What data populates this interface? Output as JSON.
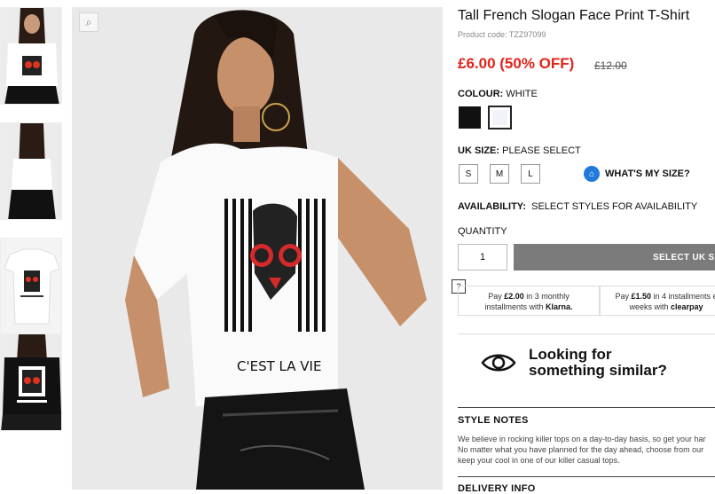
{
  "product": {
    "title": "Tall French Slogan Face Print T-Shirt",
    "code": "Product code: TZZ97099",
    "price": "£6.00 (50% OFF)",
    "was_price": "£12.00"
  },
  "gallery": {
    "thumbnails": [
      "front view",
      "back view",
      "flat lay",
      "black variant"
    ],
    "print_text": "C'EST LA VIE"
  },
  "colour": {
    "label": "COLOUR:",
    "value": "WHITE",
    "options": [
      "black",
      "white"
    ],
    "selected": "white"
  },
  "size": {
    "label": "UK SIZE:",
    "value": "PLEASE SELECT",
    "options": [
      "S",
      "M",
      "L"
    ],
    "guide": "WHAT'S MY SIZE?"
  },
  "availability": {
    "label": "AVAILABILITY:",
    "value": "SELECT STYLES FOR AVAILABILITY"
  },
  "quantity": {
    "label": "QUANTITY",
    "value": "1"
  },
  "add_button": "SELECT UK SIZE",
  "payments": {
    "badge": "?",
    "klarna_pre": "Pay ",
    "klarna_amount": "£2.00",
    "klarna_post": " in 3 monthly",
    "klarna_line2": "installments with ",
    "klarna_brand": "Klarna.",
    "clearpay_pre": "Pay ",
    "clearpay_amount": "£1.50",
    "clearpay_post": " in 4 installments e",
    "clearpay_line2": "weeks with ",
    "clearpay_brand": "clearpay"
  },
  "similar": {
    "line1": "Looking for",
    "line2": "something similar?"
  },
  "style_notes": {
    "title": "STYLE NOTES",
    "lines": [
      "We believe in rocking killer tops on a day-to-day basis, so get your har",
      "No matter what you have planned for the day ahead, choose from our",
      "keep your cool in one of our killer casual tops."
    ]
  },
  "delivery": {
    "title": "DELIVERY INFO"
  },
  "colors": {
    "price": "#e2231a",
    "button": "#7b7b7b",
    "hanger": "#1f7ad9"
  }
}
